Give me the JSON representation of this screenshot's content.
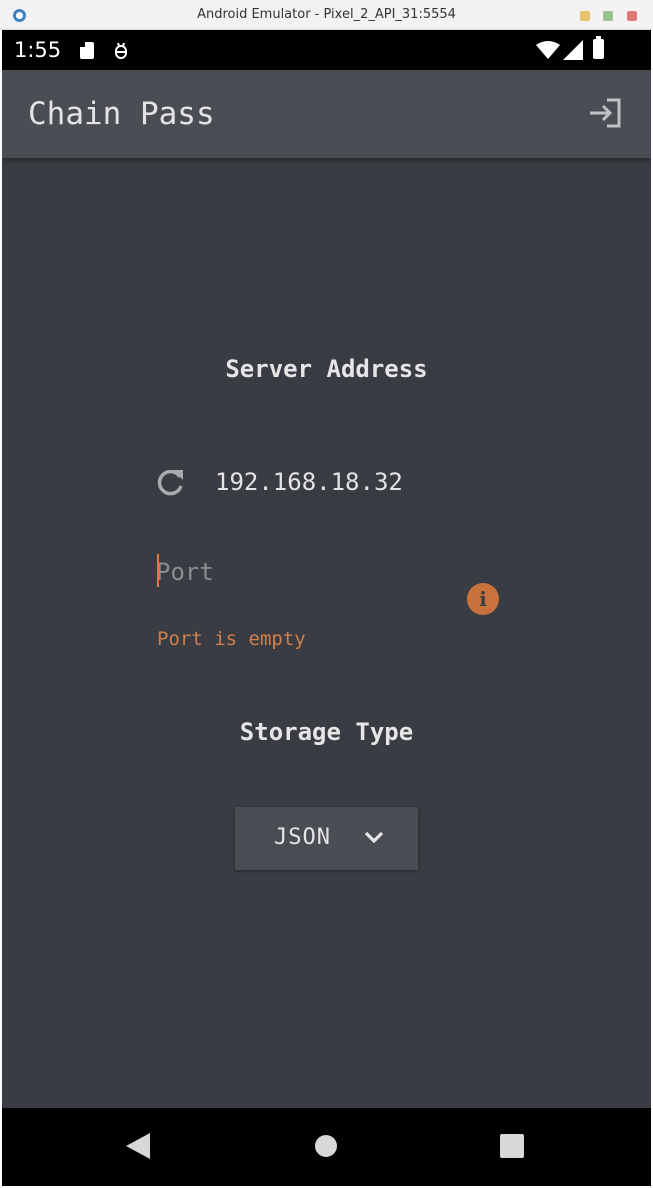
{
  "window": {
    "title": "Android Emulator - Pixel_2_API_31:5554"
  },
  "status_bar": {
    "time": "1:55"
  },
  "app_bar": {
    "title": "Chain Pass",
    "action_icon": "login-icon"
  },
  "server": {
    "section_title": "Server Address",
    "ip": "192.168.18.32",
    "refresh_icon": "refresh-icon",
    "port_placeholder": "Port",
    "port_value": "",
    "port_error": "Port is empty"
  },
  "storage": {
    "section_title": "Storage Type",
    "selected": "JSON"
  },
  "colors": {
    "background": "#393c42",
    "app_bar": "#4a4d53",
    "error_accent": "#c8723e",
    "text": "#e4e4e4"
  }
}
